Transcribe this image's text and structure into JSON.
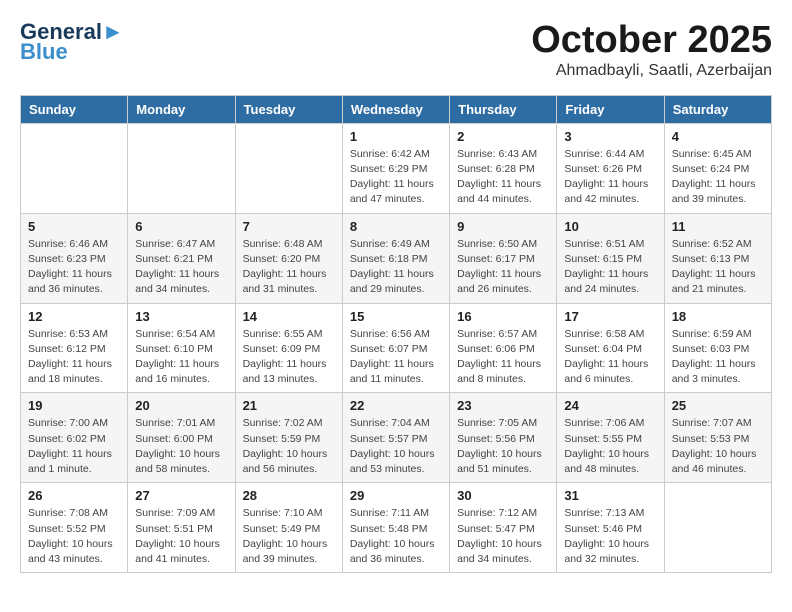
{
  "header": {
    "logo_line1": "General",
    "logo_line2": "Blue",
    "month": "October 2025",
    "location": "Ahmadbayli, Saatli, Azerbaijan"
  },
  "weekdays": [
    "Sunday",
    "Monday",
    "Tuesday",
    "Wednesday",
    "Thursday",
    "Friday",
    "Saturday"
  ],
  "weeks": [
    [
      {
        "day": "",
        "info": ""
      },
      {
        "day": "",
        "info": ""
      },
      {
        "day": "",
        "info": ""
      },
      {
        "day": "1",
        "info": "Sunrise: 6:42 AM\nSunset: 6:29 PM\nDaylight: 11 hours\nand 47 minutes."
      },
      {
        "day": "2",
        "info": "Sunrise: 6:43 AM\nSunset: 6:28 PM\nDaylight: 11 hours\nand 44 minutes."
      },
      {
        "day": "3",
        "info": "Sunrise: 6:44 AM\nSunset: 6:26 PM\nDaylight: 11 hours\nand 42 minutes."
      },
      {
        "day": "4",
        "info": "Sunrise: 6:45 AM\nSunset: 6:24 PM\nDaylight: 11 hours\nand 39 minutes."
      }
    ],
    [
      {
        "day": "5",
        "info": "Sunrise: 6:46 AM\nSunset: 6:23 PM\nDaylight: 11 hours\nand 36 minutes."
      },
      {
        "day": "6",
        "info": "Sunrise: 6:47 AM\nSunset: 6:21 PM\nDaylight: 11 hours\nand 34 minutes."
      },
      {
        "day": "7",
        "info": "Sunrise: 6:48 AM\nSunset: 6:20 PM\nDaylight: 11 hours\nand 31 minutes."
      },
      {
        "day": "8",
        "info": "Sunrise: 6:49 AM\nSunset: 6:18 PM\nDaylight: 11 hours\nand 29 minutes."
      },
      {
        "day": "9",
        "info": "Sunrise: 6:50 AM\nSunset: 6:17 PM\nDaylight: 11 hours\nand 26 minutes."
      },
      {
        "day": "10",
        "info": "Sunrise: 6:51 AM\nSunset: 6:15 PM\nDaylight: 11 hours\nand 24 minutes."
      },
      {
        "day": "11",
        "info": "Sunrise: 6:52 AM\nSunset: 6:13 PM\nDaylight: 11 hours\nand 21 minutes."
      }
    ],
    [
      {
        "day": "12",
        "info": "Sunrise: 6:53 AM\nSunset: 6:12 PM\nDaylight: 11 hours\nand 18 minutes."
      },
      {
        "day": "13",
        "info": "Sunrise: 6:54 AM\nSunset: 6:10 PM\nDaylight: 11 hours\nand 16 minutes."
      },
      {
        "day": "14",
        "info": "Sunrise: 6:55 AM\nSunset: 6:09 PM\nDaylight: 11 hours\nand 13 minutes."
      },
      {
        "day": "15",
        "info": "Sunrise: 6:56 AM\nSunset: 6:07 PM\nDaylight: 11 hours\nand 11 minutes."
      },
      {
        "day": "16",
        "info": "Sunrise: 6:57 AM\nSunset: 6:06 PM\nDaylight: 11 hours\nand 8 minutes."
      },
      {
        "day": "17",
        "info": "Sunrise: 6:58 AM\nSunset: 6:04 PM\nDaylight: 11 hours\nand 6 minutes."
      },
      {
        "day": "18",
        "info": "Sunrise: 6:59 AM\nSunset: 6:03 PM\nDaylight: 11 hours\nand 3 minutes."
      }
    ],
    [
      {
        "day": "19",
        "info": "Sunrise: 7:00 AM\nSunset: 6:02 PM\nDaylight: 11 hours\nand 1 minute."
      },
      {
        "day": "20",
        "info": "Sunrise: 7:01 AM\nSunset: 6:00 PM\nDaylight: 10 hours\nand 58 minutes."
      },
      {
        "day": "21",
        "info": "Sunrise: 7:02 AM\nSunset: 5:59 PM\nDaylight: 10 hours\nand 56 minutes."
      },
      {
        "day": "22",
        "info": "Sunrise: 7:04 AM\nSunset: 5:57 PM\nDaylight: 10 hours\nand 53 minutes."
      },
      {
        "day": "23",
        "info": "Sunrise: 7:05 AM\nSunset: 5:56 PM\nDaylight: 10 hours\nand 51 minutes."
      },
      {
        "day": "24",
        "info": "Sunrise: 7:06 AM\nSunset: 5:55 PM\nDaylight: 10 hours\nand 48 minutes."
      },
      {
        "day": "25",
        "info": "Sunrise: 7:07 AM\nSunset: 5:53 PM\nDaylight: 10 hours\nand 46 minutes."
      }
    ],
    [
      {
        "day": "26",
        "info": "Sunrise: 7:08 AM\nSunset: 5:52 PM\nDaylight: 10 hours\nand 43 minutes."
      },
      {
        "day": "27",
        "info": "Sunrise: 7:09 AM\nSunset: 5:51 PM\nDaylight: 10 hours\nand 41 minutes."
      },
      {
        "day": "28",
        "info": "Sunrise: 7:10 AM\nSunset: 5:49 PM\nDaylight: 10 hours\nand 39 minutes."
      },
      {
        "day": "29",
        "info": "Sunrise: 7:11 AM\nSunset: 5:48 PM\nDaylight: 10 hours\nand 36 minutes."
      },
      {
        "day": "30",
        "info": "Sunrise: 7:12 AM\nSunset: 5:47 PM\nDaylight: 10 hours\nand 34 minutes."
      },
      {
        "day": "31",
        "info": "Sunrise: 7:13 AM\nSunset: 5:46 PM\nDaylight: 10 hours\nand 32 minutes."
      },
      {
        "day": "",
        "info": ""
      }
    ]
  ]
}
